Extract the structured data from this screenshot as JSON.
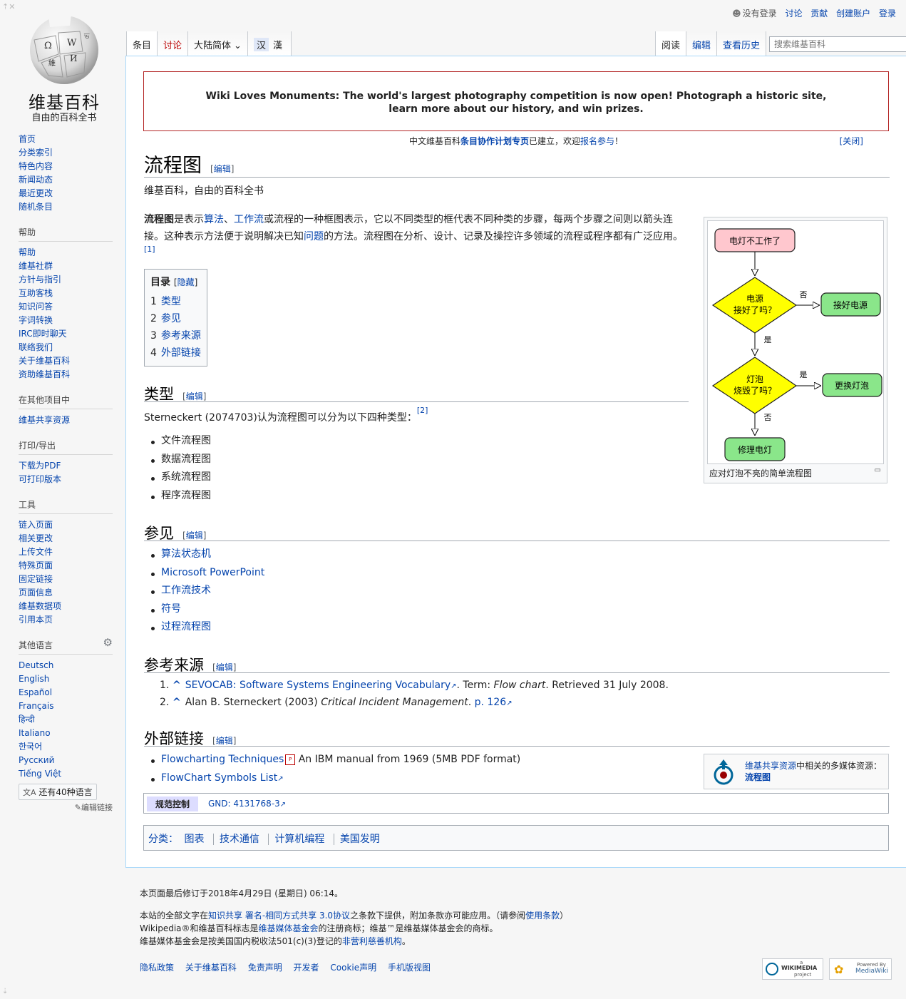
{
  "logo": {
    "name": "维基百科",
    "tagline": "自由的百科全书"
  },
  "personal": {
    "not_logged_in": "没有登录",
    "talk": "讨论",
    "contributions": "贡献",
    "create_account": "创建账户",
    "login": "登录"
  },
  "tabs_left": {
    "article": "条目",
    "talk": "讨论",
    "variant": "大陆简体",
    "hanzi1": "汉",
    "hanzi2": "漢"
  },
  "tabs_right": {
    "read": "阅读",
    "edit": "编辑",
    "history": "查看历史"
  },
  "search": {
    "placeholder": "搜索维基百科"
  },
  "sidebar": {
    "main": [
      "首页",
      "分类索引",
      "特色内容",
      "新闻动态",
      "最近更改",
      "随机条目"
    ],
    "help_head": "帮助",
    "help": [
      "帮助",
      "维基社群",
      "方针与指引",
      "互助客栈",
      "知识问答",
      "字词转换",
      "IRC即时聊天",
      "联络我们",
      "关于维基百科",
      "资助维基百科"
    ],
    "other_head": "在其他项目中",
    "other": [
      "维基共享资源"
    ],
    "print_head": "打印/导出",
    "print": [
      "下载为PDF",
      "可打印版本"
    ],
    "tools_head": "工具",
    "tools": [
      "链入页面",
      "相关更改",
      "上传文件",
      "特殊页面",
      "固定链接",
      "页面信息",
      "维基数据项",
      "引用本页"
    ],
    "lang_head": "其他语言",
    "langs": [
      "Deutsch",
      "English",
      "Español",
      "Français",
      "हिन्दी",
      "Italiano",
      "한국어",
      "Русский",
      "Tiếng Việt"
    ],
    "more_langs": "还有40种语言",
    "edit_links": "编辑链接"
  },
  "banner": {
    "line1": "Wiki Loves Monuments: The world's largest photography competition is now open! Photograph a historic site,",
    "line2": "learn more about our history, and win prizes."
  },
  "notice": {
    "pre": "中文维基百科",
    "link1": "条目协作计划专页",
    "mid": "已建立，欢迎",
    "link2": "报名参与",
    "post": "！",
    "close": "[关闭]"
  },
  "title": "流程图",
  "edit_label": "编辑",
  "tagline": "维基百科，自由的百科全书",
  "intro": {
    "bold": "流程图",
    "t1": "是表示",
    "l1": "算法",
    "t2": "、",
    "l2": "工作流",
    "t3": "或流程的一种框图表示，它以不同类型的框代表不同种类的步骤，每两个步骤之间则以箭头连接。这种表示方法便于说明解决已知",
    "l3": "问题",
    "t4": "的方法。流程图在分析、设计、记录及操控许多领域的流程或程序都有广泛应用。",
    "ref": "[1]"
  },
  "toc": {
    "title": "目录",
    "hide": "隐藏",
    "items": [
      {
        "num": "1",
        "label": "类型"
      },
      {
        "num": "2",
        "label": "参见"
      },
      {
        "num": "3",
        "label": "参考来源"
      },
      {
        "num": "4",
        "label": "外部链接"
      }
    ]
  },
  "flowchart": {
    "start": "电灯不工作了",
    "d1_line1": "电源",
    "d1_line2": "接好了吗？",
    "no": "否",
    "yes": "是",
    "fix_power": "接好电源",
    "d2_line1": "灯泡",
    "d2_line2": "烧毁了吗？",
    "replace": "更换灯泡",
    "repair": "修理电灯",
    "caption": "应对灯泡不亮的简单流程图"
  },
  "sec_types": {
    "title": "类型",
    "text": "Sterneckert (2074703)认为流程图可以分为以下四种类型：",
    "ref": "[2]",
    "items": [
      "文件流程图",
      "数据流程图",
      "系统流程图",
      "程序流程图"
    ]
  },
  "sec_see": {
    "title": "参见",
    "items": [
      "算法状态机",
      "Microsoft PowerPoint",
      "工作流技术",
      "符号",
      "过程流程图"
    ]
  },
  "sec_refs": {
    "title": "参考来源",
    "r1_num": "1.",
    "r1_link": "SEVOCAB: Software Systems Engineering Vocabulary",
    "r1_t1": ". Term: ",
    "r1_em": "Flow chart",
    "r1_t2": ". Retrieved 31 July 2008.",
    "r2_num": "2.",
    "r2_t1": "Alan B. Sterneckert (2003) ",
    "r2_em": "Critical Incident Management",
    "r2_t2": ". ",
    "r2_link": "p. 126",
    "caret": "^"
  },
  "sec_ext": {
    "title": "外部链接",
    "l1_link": "Flowcharting Techniques",
    "l1_text": " An IBM manual from 1969 (5MB PDF format)",
    "l2_link": "FlowChart Symbols List"
  },
  "commons": {
    "link1": "维基共享资源",
    "text": "中相关的多媒体资源：",
    "link2": "流程图"
  },
  "authority": {
    "label": "规范控制",
    "value": "GND: 4131768-3"
  },
  "categories": {
    "label": "分类：",
    "items": [
      "图表",
      "技术通信",
      "计算机编程",
      "美国发明"
    ]
  },
  "footer": {
    "modified": "本页面最后修订于2018年4月29日 (星期日) 06:14。",
    "l1_pre": "本站的全部文字在",
    "l1_link": "知识共享 署名-相同方式共享 3.0协议",
    "l1_mid": "之条款下提供，附加条款亦可能应用。（请参阅",
    "l1_link2": "使用条款",
    "l1_post": "）",
    "l2_pre": "Wikipedia®和维基百科标志是",
    "l2_link": "维基媒体基金会",
    "l2_post": "的注册商标；维基™是维基媒体基金会的商标。",
    "l3_pre": "维基媒体基金会是按美国国内税收法501(c)(3)登记的",
    "l3_link": "非营利慈善机构",
    "l3_post": "。",
    "links": [
      "隐私政策",
      "关于维基百科",
      "免责声明",
      "开发者",
      "Cookie声明",
      "手机版视图"
    ],
    "badge1_top": "a",
    "badge1_main": "WIKIMEDIA",
    "badge1_sub": "project",
    "badge2_top": "Powered By",
    "badge2_main": "MediaWiki"
  },
  "colors": {
    "link": "#0645ad",
    "start_box": "#ffc7ce",
    "decision": "#ffff00",
    "action": "#8ae68a",
    "banner_border": "#b32424"
  }
}
